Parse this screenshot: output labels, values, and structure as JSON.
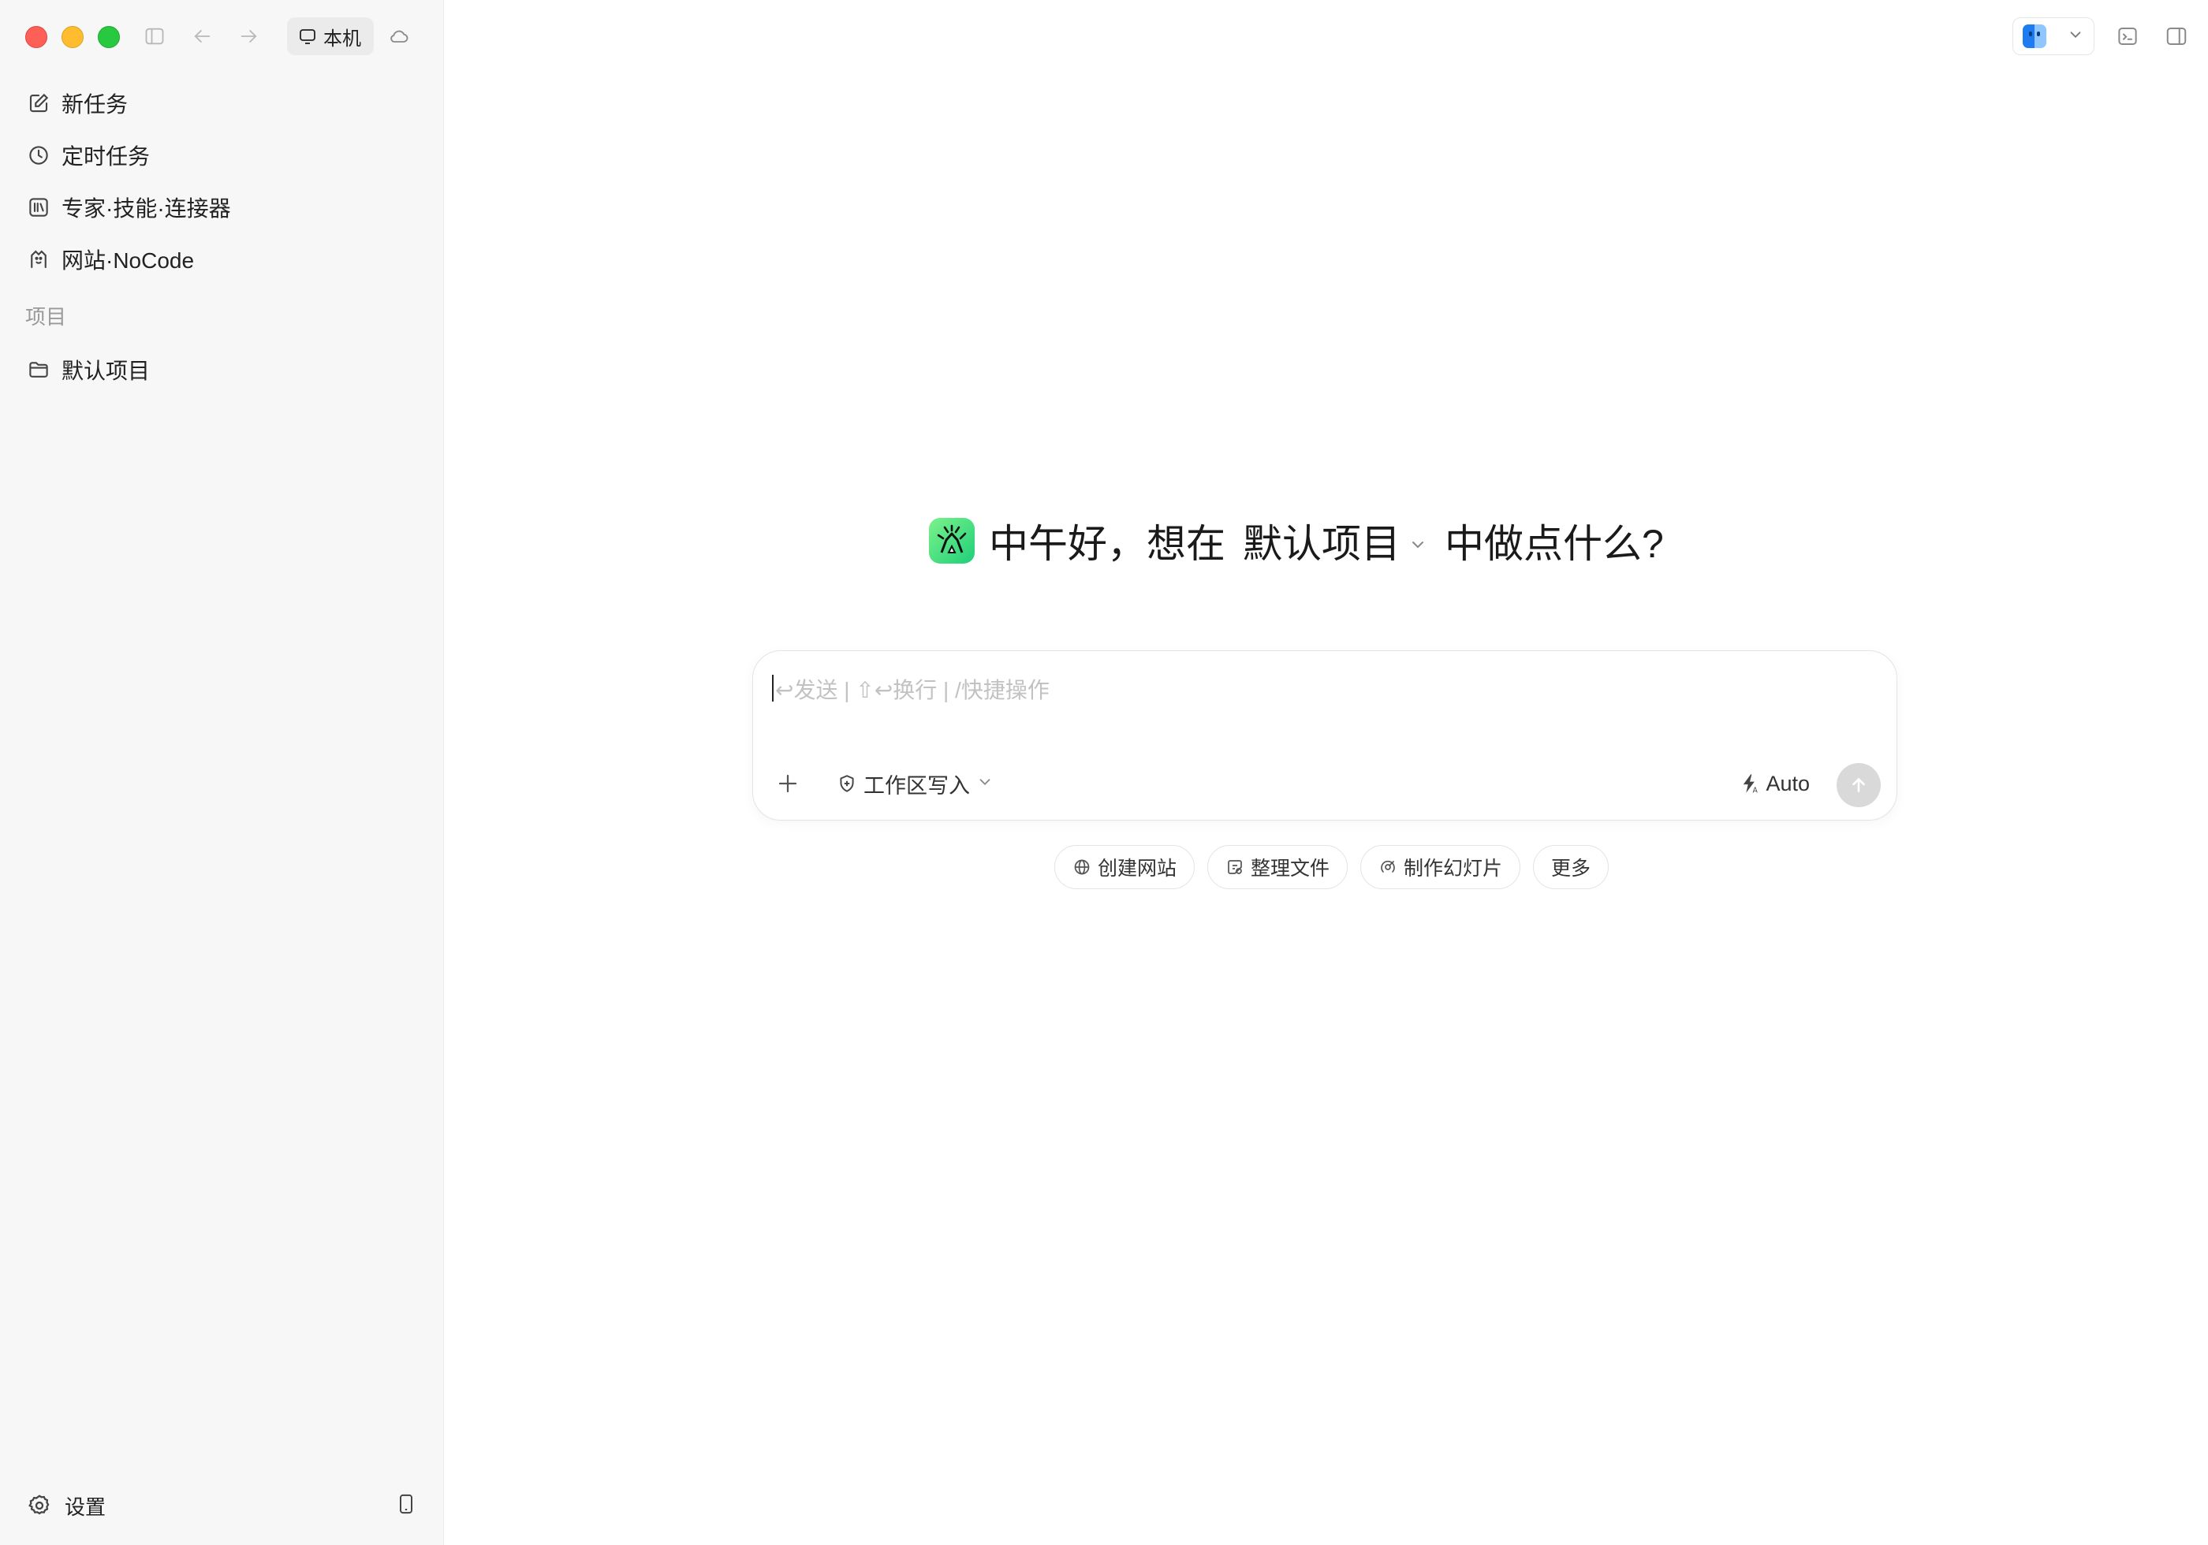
{
  "titlebar": {
    "machine_label": "本机"
  },
  "sidebar": {
    "nav": [
      {
        "label": "新任务",
        "icon": "edit-icon"
      },
      {
        "label": "定时任务",
        "icon": "clock-icon"
      },
      {
        "label": "专家·技能·连接器",
        "icon": "library-icon"
      },
      {
        "label": "网站·NoCode",
        "icon": "website-icon"
      }
    ],
    "section_label": "项目",
    "projects": [
      {
        "label": "默认项目",
        "icon": "folder-icon"
      }
    ],
    "settings_label": "设置"
  },
  "main": {
    "greeting_prefix": "中午好，想在",
    "greeting_project": "默认项目",
    "greeting_suffix": "中做点什么?",
    "composer": {
      "placeholder": "↩发送 | ⇧↩换行 | /快捷操作",
      "mode_label": "工作区写入",
      "model_label": "Auto"
    },
    "quick_actions": [
      {
        "label": "创建网站",
        "icon": "globe-icon"
      },
      {
        "label": "整理文件",
        "icon": "organize-icon"
      },
      {
        "label": "制作幻灯片",
        "icon": "slides-icon"
      },
      {
        "label": "更多",
        "icon": ""
      }
    ]
  },
  "colors": {
    "sidebar_bg": "#f7f7f7",
    "send_button": "#d9d9d9",
    "placeholder": "#c2c2c2"
  }
}
